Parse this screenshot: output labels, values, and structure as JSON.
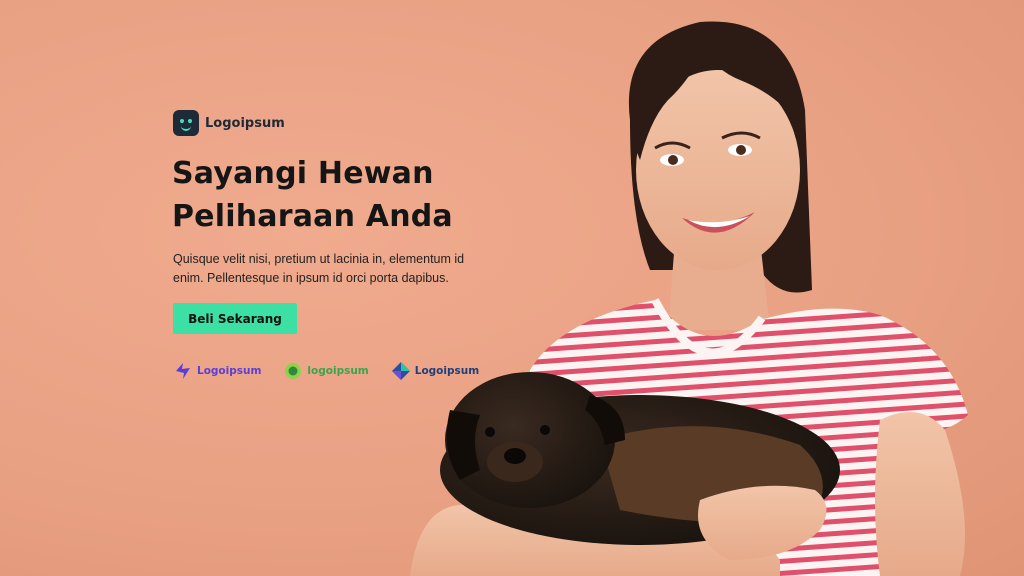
{
  "brand": {
    "name": "Logoipsum"
  },
  "hero": {
    "title_line1": "Sayangi Hewan",
    "title_line2": "Peliharaan Anda",
    "description": "Quisque velit nisi, pretium ut lacinia in, elementum id enim. Pellentesque in ipsum id orci porta dapibus.",
    "cta_label": "Beli Sekarang"
  },
  "partners": [
    {
      "name": "Logoipsum",
      "icon": "bolt-logo-icon"
    },
    {
      "name": "logoipsum",
      "icon": "speech-bubble-logo-icon"
    },
    {
      "name": "Logoipsum",
      "icon": "diamond-logo-icon"
    }
  ],
  "colors": {
    "background": "#e9a184",
    "accent": "#3de0a4",
    "text": "#151515",
    "brand_dark": "#1f2a38"
  }
}
